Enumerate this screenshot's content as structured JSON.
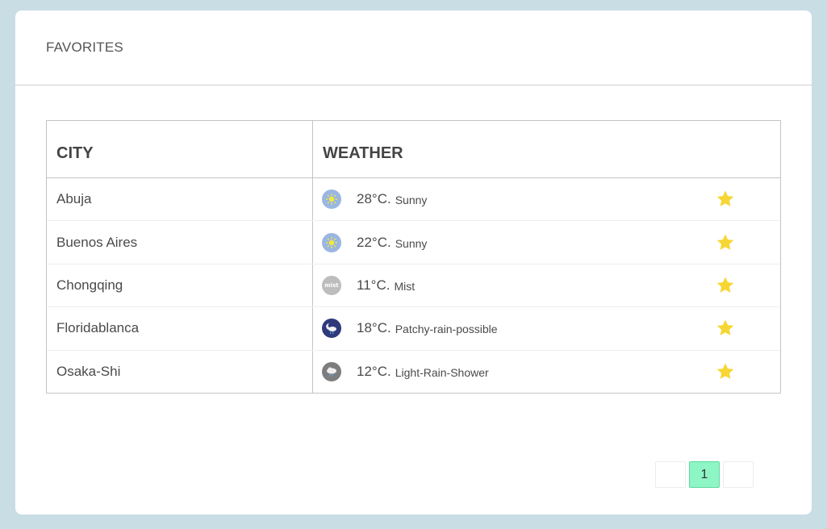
{
  "header": {
    "title": "FAVORITES"
  },
  "table": {
    "columns": [
      "CITY",
      "WEATHER"
    ],
    "rows": [
      {
        "city": "Abuja",
        "temp": "28°C.",
        "desc": "Sunny",
        "icon": "sunny-icon"
      },
      {
        "city": "Buenos Aires",
        "temp": "22°C.",
        "desc": "Sunny",
        "icon": "sunny-icon"
      },
      {
        "city": "Chongqing",
        "temp": "11°C.",
        "desc": "Mist",
        "icon": "mist-icon"
      },
      {
        "city": "Floridablanca",
        "temp": "18°C.",
        "desc": "Patchy-rain-possible",
        "icon": "patchy-rain-night-icon"
      },
      {
        "city": "Osaka-Shi",
        "temp": "12°C.",
        "desc": "Light-Rain-Shower",
        "icon": "light-rain-shower-icon"
      }
    ]
  },
  "icons": {
    "favorite": "star-icon"
  },
  "icon_text": {
    "mist": "mist"
  },
  "pagination": {
    "prev": "",
    "current": "1",
    "next": ""
  },
  "colors": {
    "background": "#c9dde5",
    "star": "#f7d633",
    "active_page": "#8ef5c4",
    "sunny_bg": "#9ab6e2",
    "sun": "#f3e93a"
  }
}
